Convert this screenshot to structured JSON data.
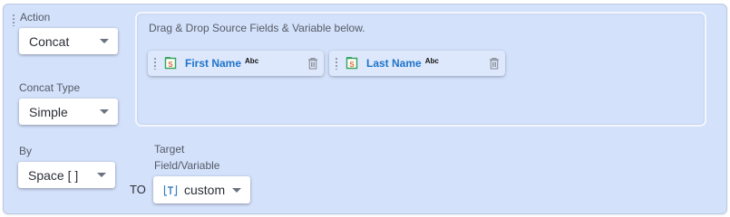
{
  "action": {
    "label": "Action",
    "value": "Concat"
  },
  "dropzone": {
    "title": "Drag & Drop Source Fields & Variable below.",
    "chips": [
      {
        "name": "First Name",
        "type": "Abc",
        "icon": "string-field-icon"
      },
      {
        "name": "Last Name",
        "type": "Abc",
        "icon": "string-field-icon"
      }
    ]
  },
  "concat_type": {
    "label": "Concat Type",
    "value": "Simple"
  },
  "by": {
    "label": "By",
    "value": "Space [ ]"
  },
  "to_label": "TO",
  "target": {
    "label_line1": "Target",
    "label_line2": "Field/Variable",
    "value": "custom",
    "icon": "text-variable-icon"
  },
  "colors": {
    "panel": "#d3e1fb",
    "chip_text": "#1f74c9",
    "icon_green": "#3aa55f",
    "icon_orange": "#e0662d"
  }
}
